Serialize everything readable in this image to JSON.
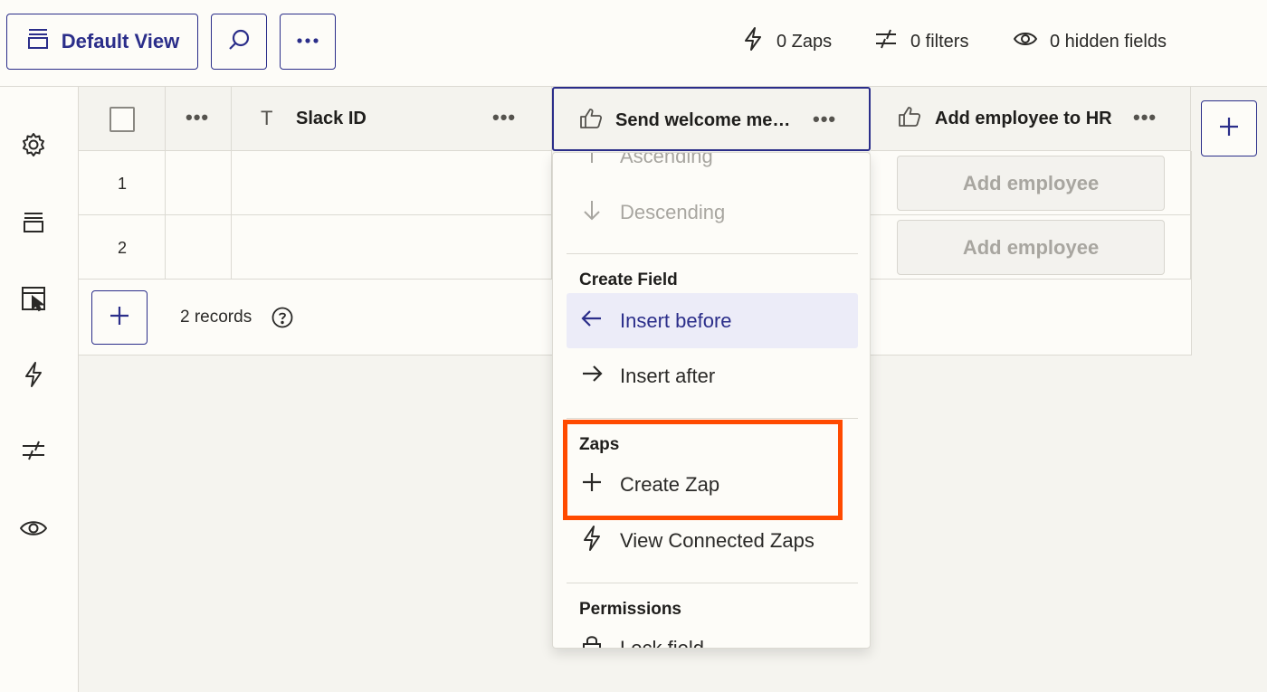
{
  "toolbar": {
    "view_label": "Default View",
    "stats": {
      "zaps": "0 Zaps",
      "filters": "0 filters",
      "hidden": "0 hidden fields"
    }
  },
  "sidebar": {
    "icons": [
      "gear-icon",
      "views-icon",
      "interface-icon",
      "zap-icon",
      "filter-icon",
      "eye-icon"
    ]
  },
  "table": {
    "columns": [
      {
        "label": "Slack ID",
        "type_icon": "text-icon"
      },
      {
        "label": "Send welcome me…",
        "type_icon": "thumbs-up-icon"
      },
      {
        "label": "Add employee to HR",
        "type_icon": "thumbs-up-icon"
      }
    ],
    "rows": [
      {
        "number": "1",
        "action_button": "Add employee"
      },
      {
        "number": "2",
        "action_button": "Add employee"
      }
    ],
    "record_count": "2 records"
  },
  "column_menu": {
    "sort_items": [
      {
        "label": "Ascending",
        "icon": "arrow-up-icon",
        "disabled": true
      },
      {
        "label": "Descending",
        "icon": "arrow-down-icon",
        "disabled": true
      }
    ],
    "create_field_title": "Create Field",
    "create_field_items": [
      {
        "label": "Insert before",
        "icon": "arrow-left-icon",
        "active": true
      },
      {
        "label": "Insert after",
        "icon": "arrow-right-icon"
      }
    ],
    "zaps_title": "Zaps",
    "zaps_items": [
      {
        "label": "Create Zap",
        "icon": "plus-icon"
      },
      {
        "label": "View Connected Zaps",
        "icon": "zap-icon"
      }
    ],
    "permissions_title": "Permissions",
    "permissions_items": [
      {
        "label": "Lock field",
        "icon": "lock-icon"
      }
    ]
  },
  "colors": {
    "accent": "#2b2e8a",
    "highlight": "#ff4a00"
  }
}
